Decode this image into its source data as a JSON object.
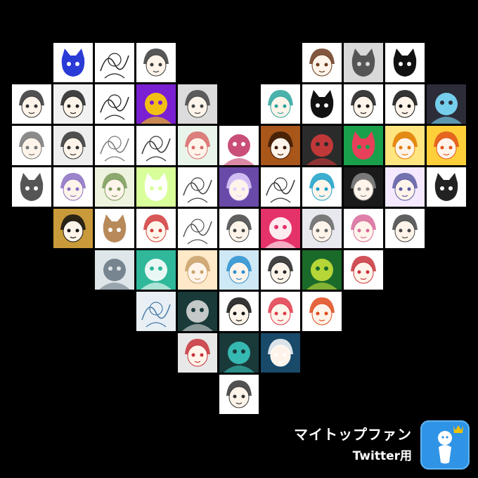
{
  "branding": {
    "title": "マイトップファン",
    "subtitle": "Twitter用",
    "logo_icon": "person-with-crown-icon",
    "logo_color": "#2f94e6",
    "crown_color": "#f2c200"
  },
  "background_color": "#000000",
  "heart_rows": [
    {
      "row": 0,
      "tiles": [
        {
          "col": 1,
          "bg": "#ffffff",
          "fg": "#2b3bd6",
          "kind": "cat"
        },
        {
          "col": 2,
          "bg": "#ffffff",
          "fg": "#222222",
          "kind": "sketch"
        },
        {
          "col": 3,
          "bg": "#ffffff",
          "fg": "#3a3a3a",
          "kind": "face"
        },
        {
          "col": 7,
          "bg": "#ffffff",
          "fg": "#6b3a1d",
          "kind": "face"
        },
        {
          "col": 8,
          "bg": "#d9d9d9",
          "fg": "#555555",
          "kind": "cat"
        },
        {
          "col": 9,
          "bg": "#ffffff",
          "fg": "#111111",
          "kind": "cat"
        }
      ]
    },
    {
      "row": 1,
      "tiles": [
        {
          "col": 0,
          "bg": "#ffffff",
          "fg": "#333333",
          "kind": "face"
        },
        {
          "col": 1,
          "bg": "#f2f2f2",
          "fg": "#222222",
          "kind": "face"
        },
        {
          "col": 2,
          "bg": "#ffffff",
          "fg": "#222222",
          "kind": "sketch"
        },
        {
          "col": 3,
          "bg": "#7a1fd1",
          "fg": "#ffd000",
          "kind": "blob"
        },
        {
          "col": 4,
          "bg": "#dcdcdc",
          "fg": "#444444",
          "kind": "face"
        },
        {
          "col": 6,
          "bg": "#ffffff",
          "fg": "#2aa59c",
          "kind": "face"
        },
        {
          "col": 7,
          "bg": "#ffffff",
          "fg": "#111111",
          "kind": "cat"
        },
        {
          "col": 8,
          "bg": "#ffffff",
          "fg": "#1a1a1a",
          "kind": "face"
        },
        {
          "col": 9,
          "bg": "#ffffff",
          "fg": "#111111",
          "kind": "face"
        },
        {
          "col": 10,
          "bg": "#2d2d3a",
          "fg": "#7de0ff",
          "kind": "blob"
        }
      ]
    },
    {
      "row": 2,
      "tiles": [
        {
          "col": 0,
          "bg": "#ffffff",
          "fg": "#777777",
          "kind": "face"
        },
        {
          "col": 1,
          "bg": "#eeeeee",
          "fg": "#333333",
          "kind": "face"
        },
        {
          "col": 2,
          "bg": "#ffffff",
          "fg": "#777777",
          "kind": "sketch"
        },
        {
          "col": 3,
          "bg": "#ffffff",
          "fg": "#333333",
          "kind": "sketch"
        },
        {
          "col": 4,
          "bg": "#e9f5ea",
          "fg": "#d86a6a",
          "kind": "face"
        },
        {
          "col": 5,
          "bg": "#ffffff",
          "fg": "#c33c6a",
          "kind": "blob"
        },
        {
          "col": 6,
          "bg": "#a8561a",
          "fg": "#3a1a05",
          "kind": "face"
        },
        {
          "col": 7,
          "bg": "#2b2b2b",
          "fg": "#d23a3a",
          "kind": "blob"
        },
        {
          "col": 8,
          "bg": "#1aa04a",
          "fg": "#e8405a",
          "kind": "cat"
        },
        {
          "col": 9,
          "bg": "#ffe680",
          "fg": "#e07a00",
          "kind": "face"
        },
        {
          "col": 10,
          "bg": "#ffcf3a",
          "fg": "#e0541a",
          "kind": "face"
        }
      ]
    },
    {
      "row": 3,
      "tiles": [
        {
          "col": 0,
          "bg": "#ffffff",
          "fg": "#555555",
          "kind": "cat"
        },
        {
          "col": 1,
          "bg": "#ffffff",
          "fg": "#8b6fc2",
          "kind": "face"
        },
        {
          "col": 2,
          "bg": "#eef3df",
          "fg": "#7a9a5a",
          "kind": "face"
        },
        {
          "col": 3,
          "bg": "#d9ff9a",
          "fg": "#ffffff",
          "kind": "cat"
        },
        {
          "col": 4,
          "bg": "#ffffff",
          "fg": "#444444",
          "kind": "sketch"
        },
        {
          "col": 5,
          "bg": "#6a4aa8",
          "fg": "#e0d0ff",
          "kind": "face"
        },
        {
          "col": 6,
          "bg": "#ffffff",
          "fg": "#333333",
          "kind": "sketch"
        },
        {
          "col": 7,
          "bg": "#ffffff",
          "fg": "#1aa0c8",
          "kind": "face"
        },
        {
          "col": 8,
          "bg": "#1a1a1a",
          "fg": "#8a8a8a",
          "kind": "face"
        },
        {
          "col": 9,
          "bg": "#f4e9ff",
          "fg": "#5a5aa0",
          "kind": "face"
        },
        {
          "col": 10,
          "bg": "#ffffff",
          "fg": "#222222",
          "kind": "cat"
        }
      ]
    },
    {
      "row": 4,
      "tiles": [
        {
          "col": 1,
          "bg": "#c99a3a",
          "fg": "#111111",
          "kind": "face"
        },
        {
          "col": 2,
          "bg": "#ffffff",
          "fg": "#b88a5a",
          "kind": "cat"
        },
        {
          "col": 3,
          "bg": "#ffffff",
          "fg": "#d23a3a",
          "kind": "face"
        },
        {
          "col": 4,
          "bg": "#ffffff",
          "fg": "#555555",
          "kind": "sketch"
        },
        {
          "col": 5,
          "bg": "#ffffff",
          "fg": "#444444",
          "kind": "face"
        },
        {
          "col": 6,
          "bg": "#e5336a",
          "fg": "#ffffff",
          "kind": "blob"
        },
        {
          "col": 7,
          "bg": "#e8e8ef",
          "fg": "#666666",
          "kind": "face"
        },
        {
          "col": 8,
          "bg": "#ffffff",
          "fg": "#d86a9a",
          "kind": "face"
        },
        {
          "col": 9,
          "bg": "#ffffff",
          "fg": "#444444",
          "kind": "face"
        }
      ]
    },
    {
      "row": 5,
      "tiles": [
        {
          "col": 2,
          "bg": "#dfe6ea",
          "fg": "#6a7a86",
          "kind": "blob"
        },
        {
          "col": 3,
          "bg": "#2fb89a",
          "fg": "#ffffff",
          "kind": "blob"
        },
        {
          "col": 4,
          "bg": "#ffe9c8",
          "fg": "#c8a06a",
          "kind": "face"
        },
        {
          "col": 5,
          "bg": "#cfe8f5",
          "fg": "#2a8fd0",
          "kind": "face"
        },
        {
          "col": 6,
          "bg": "#ffffff",
          "fg": "#222222",
          "kind": "face"
        },
        {
          "col": 7,
          "bg": "#1a6a2a",
          "fg": "#c8e23a",
          "kind": "blob"
        },
        {
          "col": 8,
          "bg": "#ffffff",
          "fg": "#c8323a",
          "kind": "face"
        }
      ]
    },
    {
      "row": 6,
      "tiles": [
        {
          "col": 3,
          "bg": "#e8f0f5",
          "fg": "#4a7aa8",
          "kind": "sketch"
        },
        {
          "col": 4,
          "bg": "#1a3a3a",
          "fg": "#d8d8d8",
          "kind": "blob"
        },
        {
          "col": 5,
          "bg": "#ffffff",
          "fg": "#111111",
          "kind": "face"
        },
        {
          "col": 6,
          "bg": "#ffffff",
          "fg": "#e03a4a",
          "kind": "face"
        },
        {
          "col": 7,
          "bg": "#ffffff",
          "fg": "#e04a1a",
          "kind": "face"
        }
      ]
    },
    {
      "row": 7,
      "tiles": [
        {
          "col": 4,
          "bg": "#e8e8e8",
          "fg": "#c8323a",
          "kind": "face"
        },
        {
          "col": 5,
          "bg": "#1a3a3a",
          "fg": "#3ac8c0",
          "kind": "blob"
        },
        {
          "col": 6,
          "bg": "#1a4a6a",
          "fg": "#ffffff",
          "kind": "face"
        }
      ]
    },
    {
      "row": 8,
      "tiles": [
        {
          "col": 5,
          "bg": "#ffffff",
          "fg": "#333333",
          "kind": "face"
        }
      ]
    }
  ]
}
